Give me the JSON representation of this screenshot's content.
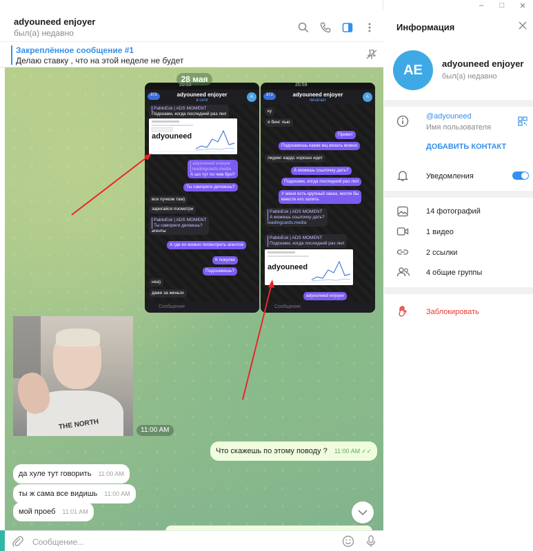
{
  "chat": {
    "title": "adyouneed enjoyer",
    "status": "был(а) недавно",
    "pinned": {
      "title": "Закреплённое сообщение #1",
      "text": "Делаю ставку , что на этой неделе не будет"
    },
    "date_label": "28 мая",
    "photo_time": "11:00 AM",
    "messages": [
      {
        "text": "Что скажешь по этому поводу ?",
        "time": "11:00 AM",
        "dir": "out"
      },
      {
        "text": "да хуле тут говорить",
        "time": "11:00 AM",
        "dir": "in"
      },
      {
        "text": "ты ж сама все видишь",
        "time": "11:00 AM",
        "dir": "in"
      },
      {
        "text": "мой проеб",
        "time": "11:01 AM",
        "dir": "in"
      }
    ],
    "composer_placeholder": "Сообщение..."
  },
  "screenshots": {
    "left": {
      "status": "20:59",
      "back": "372",
      "name": "adyouneed enjoyer",
      "sub": "в сети",
      "avatar": "A",
      "reply_author": "PabloEsk | ADS MOMENT",
      "reply_text": "Подскажи, когда последний раз лил",
      "brand": "adyouneed",
      "bubbles": [
        {
          "reply": "adyouneed enjoyer",
          "reply2": "leadingcards.media",
          "text": "А шо тут по чем бро?",
          "dir": "out"
        },
        {
          "text": "Ты самореги делаешь?",
          "dir": "out"
        },
        {
          "text": "все пучком там)",
          "dir": "in"
        },
        {
          "text": "зарегайся посмотри",
          "dir": "in"
        },
        {
          "reply": "PabloEsk | ADS MOMENT",
          "reply2": "Ты самореги делаешь?",
          "text": "агенты",
          "dir": "in"
        },
        {
          "text": "А где их можно посмотреть агентов",
          "dir": "out"
        },
        {
          "text": "К покупке",
          "dir": "out"
        },
        {
          "text": "Подскажешь?",
          "dir": "out"
        },
        {
          "text": "неа)",
          "dir": "in"
        },
        {
          "text": "даже за женьги",
          "dir": "in"
        }
      ],
      "composer": "Сообщение"
    },
    "right": {
      "status": "20:59",
      "back": "372",
      "name": "adyouneed enjoyer",
      "sub": "печатает",
      "avatar": "A",
      "brand": "adyouneed",
      "bottom_reply": "adyouneed enjoyer",
      "bubbles": [
        {
          "text": "ку",
          "dir": "in"
        },
        {
          "text": "я бинг лью",
          "dir": "in"
        },
        {
          "text": "Привет",
          "dir": "out"
        },
        {
          "text": "Подскажешь какие вщ вязать можно",
          "dir": "out"
        },
        {
          "text": "лидинг кардс хорошо идет",
          "dir": "in"
        },
        {
          "text": "А можешь ссылочку дать?",
          "dir": "out"
        },
        {
          "text": "Подскажи, когда последний раз лил",
          "dir": "out"
        },
        {
          "text": "У меня есть крупный заказ, могли бы",
          "text2": "вместе его залить",
          "dir": "out"
        },
        {
          "reply": "PabloEsk | ADS MOMENT",
          "reply2": "А можешь ссылочку дать?",
          "text": "leadingcards.media",
          "dir": "in"
        },
        {
          "reply": "PabloEsk | ADS MOMENT",
          "reply2": "Подскажи, когда последний раз лил",
          "text": "",
          "dir": "in"
        }
      ],
      "composer": "Сообщение"
    }
  },
  "info": {
    "title": "Информация",
    "avatar_initials": "AE",
    "name": "adyouneed enjoyer",
    "status": "был(а) недавно",
    "username": "@adyouneed",
    "username_caption": "Имя пользователя",
    "add_contact": "ДОБАВИТЬ КОНТАКТ",
    "notifications": "Уведомления",
    "notifications_on": true,
    "media": [
      {
        "icon": "photo-icon",
        "label": "14 фотографий"
      },
      {
        "icon": "video-icon",
        "label": "1 видео"
      },
      {
        "icon": "link-icon",
        "label": "2 ссылки"
      },
      {
        "icon": "group-icon",
        "label": "4 общие группы"
      }
    ],
    "block": "Заблокировать"
  },
  "colors": {
    "accent": "#3390ec",
    "danger": "#e53935",
    "avatar": "#3fa9e6",
    "outgoing": "#effdde",
    "tg_purple": "#7b5cf0"
  }
}
